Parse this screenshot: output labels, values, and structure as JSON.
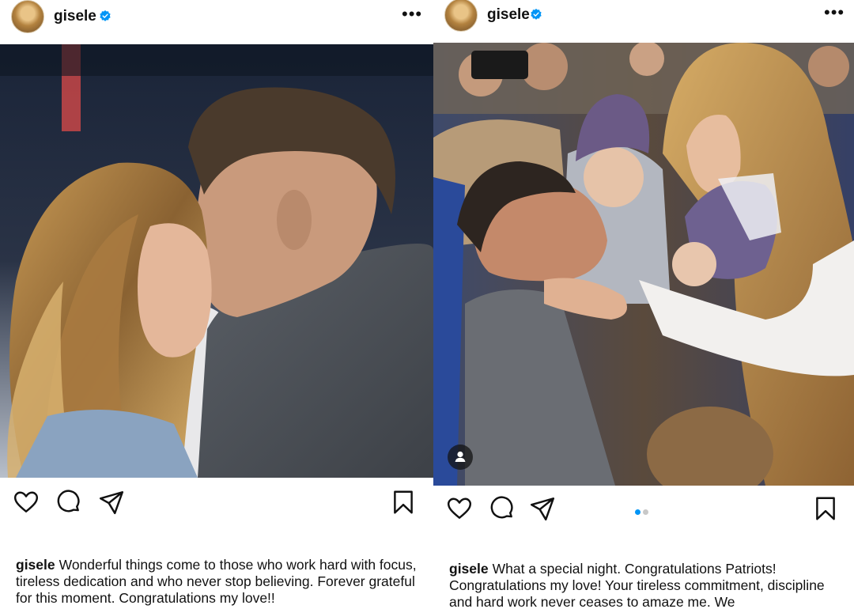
{
  "posts": [
    {
      "username": "gisele",
      "verified": true,
      "more_label": "•••",
      "photo_alt": "",
      "caption_user": "gisele",
      "caption_text": "Wonderful things come to those who work hard with focus, tireless dedication and who never stop believing. Forever grateful for this moment. Congratulations my love!!",
      "icons": [
        "heart-icon",
        "comment-icon",
        "share-icon",
        "bookmark-icon"
      ]
    },
    {
      "username": "gisele",
      "verified": true,
      "more_label": "•••",
      "caption_user": "gisele",
      "caption_text": "What a special night. Congratulations Patriots! Congratulations my love! Your tireless commitment, discipline and hard work never ceases to amaze me. We",
      "carousel": {
        "count": 2,
        "active": 1
      },
      "icons": [
        "heart-icon",
        "comment-icon",
        "share-icon",
        "bookmark-icon",
        "user-tag-icon"
      ]
    }
  ],
  "colors": {
    "verified_blue": "#0095f6",
    "carousel_active": "#0095f6",
    "carousel_inactive": "#c8c8c8",
    "text": "#111111"
  }
}
